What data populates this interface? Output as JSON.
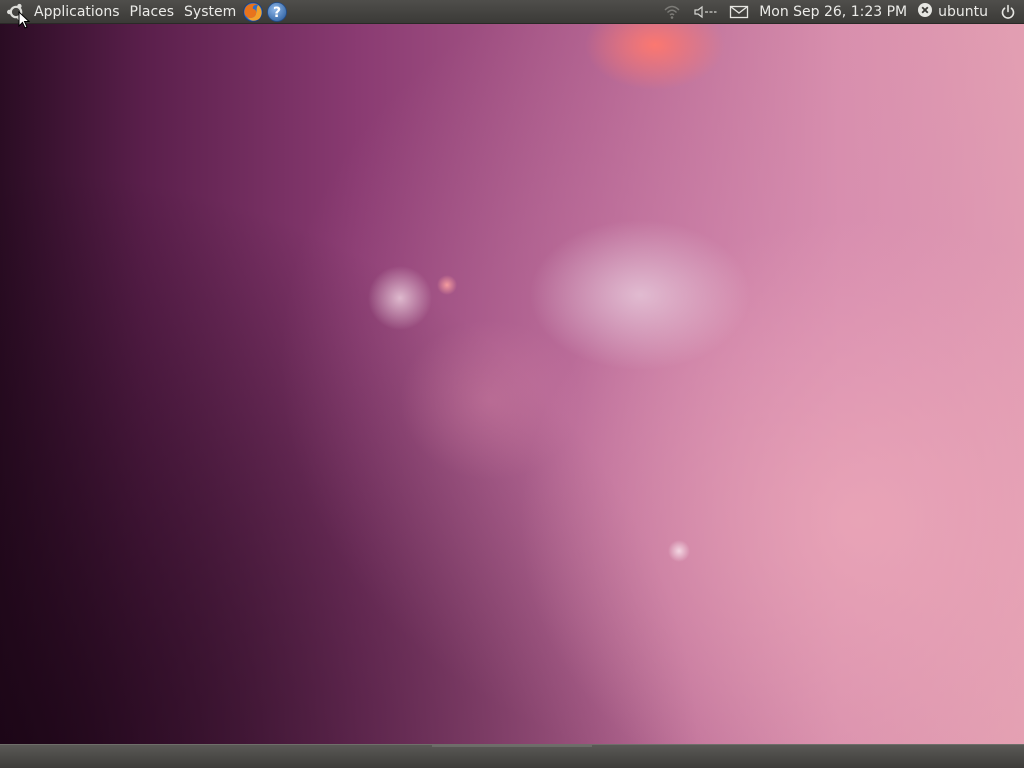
{
  "top_panel": {
    "menus": {
      "applications": "Applications",
      "places": "Places",
      "system": "System"
    },
    "launchers": [
      "firefox-icon",
      "help-icon"
    ],
    "help_glyph": "?",
    "tray": {
      "network": "wireless-signal-icon",
      "volume": "speaker-icon",
      "mail": "envelope-icon"
    },
    "clock": "Mon Sep 26,  1:23 PM",
    "user": {
      "name": "ubuntu",
      "status_icon": "user-status-icon"
    },
    "power": "power-icon"
  },
  "colors": {
    "panel": "#3b3a37",
    "panel_text": "#ebebe8",
    "wallpaper_base": "#8a3b72"
  }
}
